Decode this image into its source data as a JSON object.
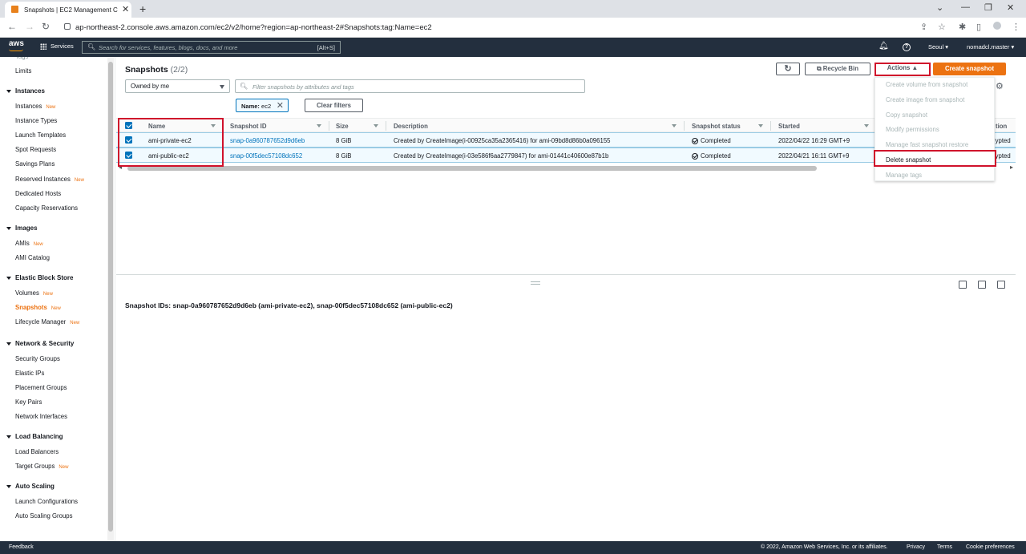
{
  "browser": {
    "tab_title": "Snapshots | EC2 Management C",
    "url": "ap-northeast-2.console.aws.amazon.com/ec2/v2/home?region=ap-northeast-2#Snapshots:tag:Name=ec2"
  },
  "topnav": {
    "logo": "aws",
    "services": "Services",
    "search_placeholder": "Search for services, features, blogs, docs, and more",
    "search_shortcut": "[Alt+S]",
    "region": "Seoul",
    "user": "nomadcl.master"
  },
  "sidebar": {
    "cut_item": "Tags",
    "limits": "Limits",
    "new_badge": "New",
    "sections": [
      {
        "title": "Instances",
        "items": [
          {
            "label": "Instances",
            "new": true
          },
          {
            "label": "Instance Types",
            "new": false
          },
          {
            "label": "Launch Templates",
            "new": false
          },
          {
            "label": "Spot Requests",
            "new": false
          },
          {
            "label": "Savings Plans",
            "new": false
          },
          {
            "label": "Reserved Instances",
            "new": true
          },
          {
            "label": "Dedicated Hosts",
            "new": false
          },
          {
            "label": "Capacity Reservations",
            "new": false
          }
        ]
      },
      {
        "title": "Images",
        "items": [
          {
            "label": "AMIs",
            "new": true
          },
          {
            "label": "AMI Catalog",
            "new": false
          }
        ]
      },
      {
        "title": "Elastic Block Store",
        "items": [
          {
            "label": "Volumes",
            "new": true
          },
          {
            "label": "Snapshots",
            "new": true,
            "active": true
          },
          {
            "label": "Lifecycle Manager",
            "new": true
          }
        ]
      },
      {
        "title": "Network & Security",
        "items": [
          {
            "label": "Security Groups",
            "new": false
          },
          {
            "label": "Elastic IPs",
            "new": false
          },
          {
            "label": "Placement Groups",
            "new": false
          },
          {
            "label": "Key Pairs",
            "new": false
          },
          {
            "label": "Network Interfaces",
            "new": false
          }
        ]
      },
      {
        "title": "Load Balancing",
        "items": [
          {
            "label": "Load Balancers",
            "new": false
          },
          {
            "label": "Target Groups",
            "new": true
          }
        ]
      },
      {
        "title": "Auto Scaling",
        "items": [
          {
            "label": "Launch Configurations",
            "new": false
          },
          {
            "label": "Auto Scaling Groups",
            "new": false
          }
        ]
      }
    ]
  },
  "main": {
    "title": "Snapshots",
    "count": "(2/2)",
    "refresh_icon": "refresh-icon",
    "recycle_bin": "Recycle Bin",
    "actions": "Actions",
    "create_snapshot": "Create snapshot",
    "owned_by": "Owned by me",
    "filter_placeholder": "Filter snapshots by attributes and tags",
    "token_key": "Name:",
    "token_value": "ec2",
    "clear_filters": "Clear filters"
  },
  "table": {
    "headers": {
      "name": "Name",
      "snapshot_id": "Snapshot ID",
      "size": "Size",
      "description": "Description",
      "status": "Snapshot status",
      "started": "Started",
      "encryption_partial": "tion"
    },
    "rows": [
      {
        "name": "ami-private-ec2",
        "snapshot_id": "snap-0a960787652d9d6eb",
        "size": "8 GiB",
        "description": "Created by CreateImage(i-00925ca35a2365416) for ami-09bd8d86b0a096155",
        "status": "Completed",
        "started": "2022/04/22 16:29 GMT+9",
        "encryption_partial": "rypted"
      },
      {
        "name": "ami-public-ec2",
        "snapshot_id": "snap-00f5dec57108dc652",
        "size": "8 GiB",
        "description": "Created by CreateImage(i-03e586f6aa2779847) for ami-01441c40600e87b1b",
        "status": "Completed",
        "started": "2022/04/21 16:11 GMT+9",
        "encryption_partial": "rypted"
      }
    ]
  },
  "actions_menu": [
    {
      "label": "Create volume from snapshot",
      "enabled": false
    },
    {
      "label": "Create image from snapshot",
      "enabled": false
    },
    {
      "label": "Copy snapshot",
      "enabled": false
    },
    {
      "label": "Modify permissions",
      "enabled": false
    },
    {
      "label": "Manage fast snapshot restore",
      "enabled": false
    },
    {
      "label": "Delete snapshot",
      "enabled": true
    },
    {
      "label": "Manage tags",
      "enabled": false
    }
  ],
  "split_panel": {
    "text": "Snapshot IDs: snap-0a960787652d9d6eb (ami-private-ec2), snap-00f5dec57108dc652 (ami-public-ec2)"
  },
  "footer": {
    "feedback": "Feedback",
    "copyright": "© 2022, Amazon Web Services, Inc. or its affiliates.",
    "privacy": "Privacy",
    "terms": "Terms",
    "cookie": "Cookie preferences"
  },
  "colors": {
    "aws_nav": "#232f3e",
    "accent_orange": "#ec7211",
    "link_blue": "#0073bb",
    "highlight_red": "#d0112b"
  }
}
